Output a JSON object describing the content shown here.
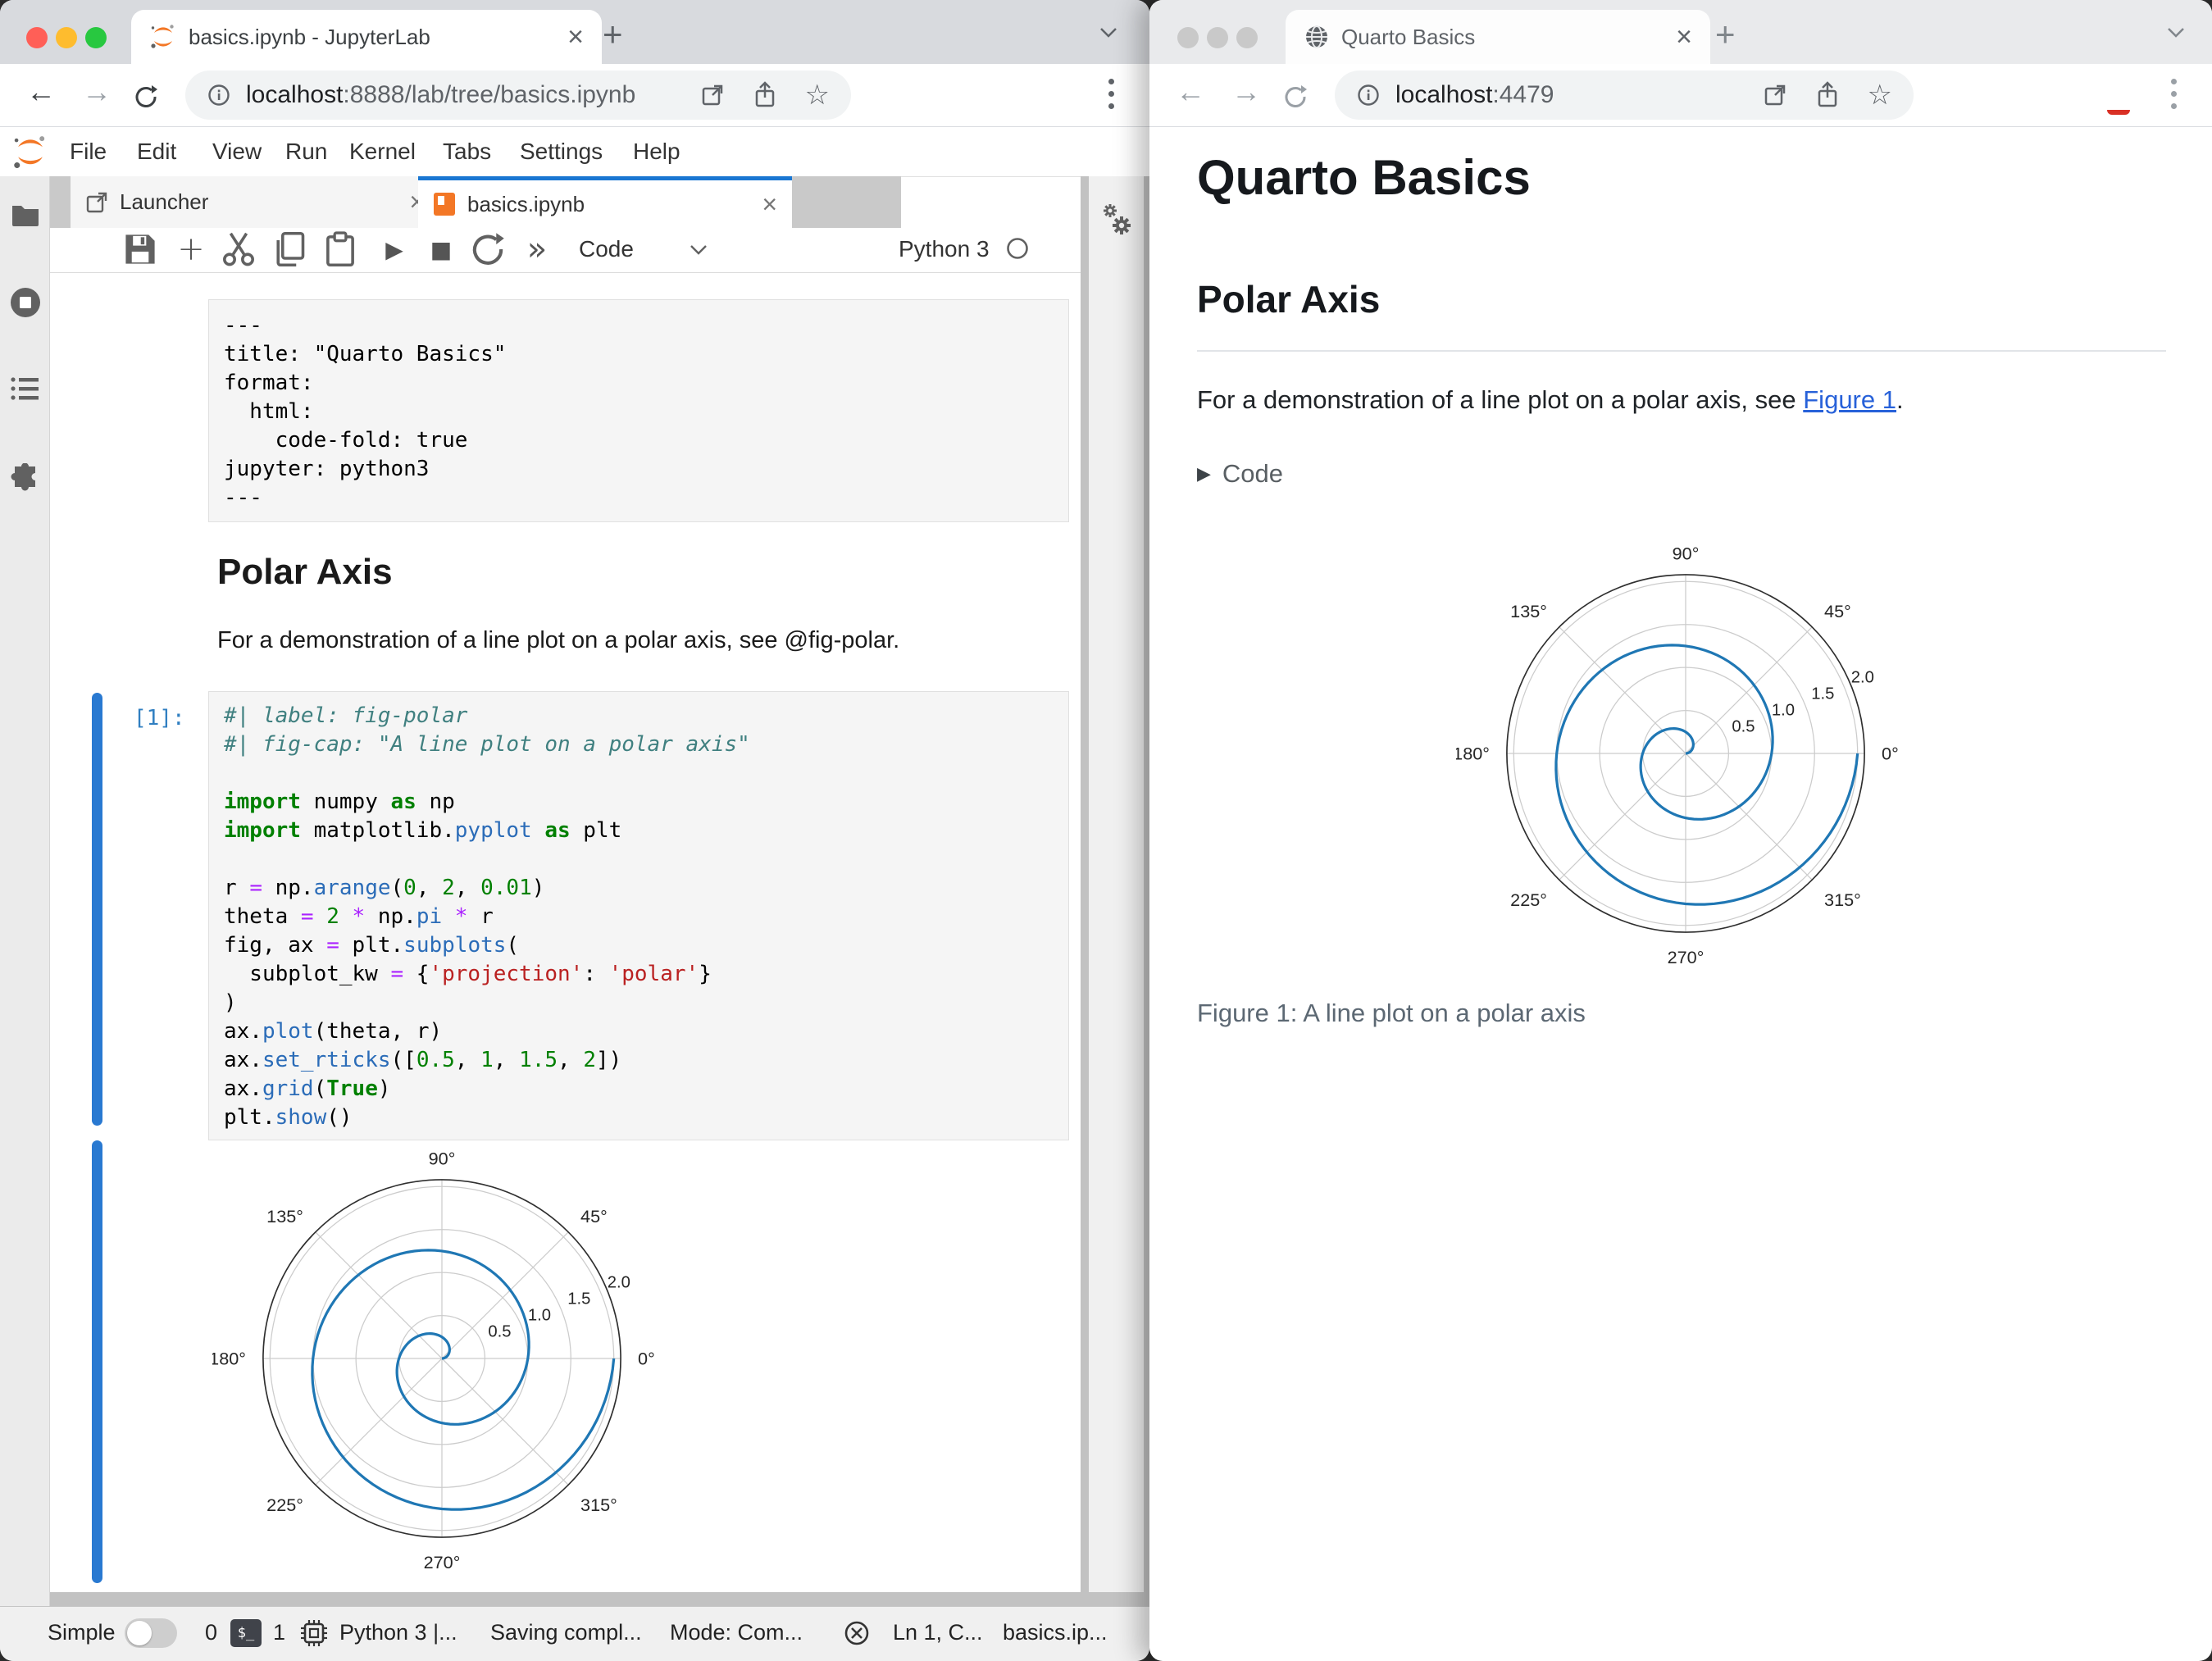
{
  "colors": {
    "accent_blue": "#2979d1",
    "tab_active_bar": "#1976d2",
    "jupyter_orange": "#f37726",
    "plot_line": "#1f77b4",
    "link_blue": "#2761d9",
    "traffic_red": "#ff5f57",
    "traffic_yellow": "#febc2e",
    "traffic_green": "#28c840",
    "traffic_inactive": "#c9c9c9"
  },
  "icons": {
    "back": "←",
    "forward": "→",
    "star": "☆",
    "plus": "+",
    "close": "×",
    "run": "▶",
    "stop": "■",
    "fastforward": "»",
    "caret": "⌄",
    "disclosure": "▶"
  },
  "left_window": {
    "tab_title": "basics.ipynb - JupyterLab",
    "url_host": "localhost",
    "url_rest": ":8888/lab/tree/basics.ipynb",
    "menus": [
      "File",
      "Edit",
      "View",
      "Run",
      "Kernel",
      "Tabs",
      "Settings",
      "Help"
    ],
    "doc_tabs": {
      "launcher": "Launcher",
      "notebook": "basics.ipynb"
    },
    "toolbar": {
      "cell_type": "Code",
      "kernel_name": "Python 3"
    },
    "yaml_lines": [
      "---",
      "title: \"Quarto Basics\"",
      "format:",
      "  html:",
      "    code-fold: true",
      "jupyter: python3",
      "---"
    ],
    "md_heading": "Polar Axis",
    "md_text": "For a demonstration of a line plot on a polar axis, see @fig-polar.",
    "prompt": "[1]:",
    "code_lines": [
      [
        {
          "c": "cm",
          "t": "#| label: fig-polar"
        }
      ],
      [
        {
          "c": "cm",
          "t": "#| fig-cap: \"A line plot on a polar axis\""
        }
      ],
      [],
      [
        {
          "c": "kw",
          "t": "import"
        },
        {
          "c": "pl",
          "t": " numpy "
        },
        {
          "c": "kw",
          "t": "as"
        },
        {
          "c": "pl",
          "t": " np"
        }
      ],
      [
        {
          "c": "kw",
          "t": "import"
        },
        {
          "c": "pl",
          "t": " matplotlib."
        },
        {
          "c": "fn",
          "t": "pyplot"
        },
        {
          "c": "pl",
          "t": " "
        },
        {
          "c": "kw",
          "t": "as"
        },
        {
          "c": "pl",
          "t": " plt"
        }
      ],
      [],
      [
        {
          "c": "pl",
          "t": "r "
        },
        {
          "c": "op",
          "t": "="
        },
        {
          "c": "pl",
          "t": " np."
        },
        {
          "c": "fn",
          "t": "arange"
        },
        {
          "c": "pl",
          "t": "("
        },
        {
          "c": "nb",
          "t": "0"
        },
        {
          "c": "pl",
          "t": ", "
        },
        {
          "c": "nb",
          "t": "2"
        },
        {
          "c": "pl",
          "t": ", "
        },
        {
          "c": "nb",
          "t": "0.01"
        },
        {
          "c": "pl",
          "t": ")"
        }
      ],
      [
        {
          "c": "pl",
          "t": "theta "
        },
        {
          "c": "op",
          "t": "="
        },
        {
          "c": "pl",
          "t": " "
        },
        {
          "c": "nb",
          "t": "2"
        },
        {
          "c": "pl",
          "t": " "
        },
        {
          "c": "op",
          "t": "*"
        },
        {
          "c": "pl",
          "t": " np."
        },
        {
          "c": "fn",
          "t": "pi"
        },
        {
          "c": "pl",
          "t": " "
        },
        {
          "c": "op",
          "t": "*"
        },
        {
          "c": "pl",
          "t": " r"
        }
      ],
      [
        {
          "c": "pl",
          "t": "fig, ax "
        },
        {
          "c": "op",
          "t": "="
        },
        {
          "c": "pl",
          "t": " plt."
        },
        {
          "c": "fn",
          "t": "subplots"
        },
        {
          "c": "pl",
          "t": "("
        }
      ],
      [
        {
          "c": "pl",
          "t": "  subplot_kw "
        },
        {
          "c": "op",
          "t": "="
        },
        {
          "c": "pl",
          "t": " {"
        },
        {
          "c": "st",
          "t": "'projection'"
        },
        {
          "c": "pl",
          "t": ": "
        },
        {
          "c": "st",
          "t": "'polar'"
        },
        {
          "c": "pl",
          "t": "}"
        }
      ],
      [
        {
          "c": "pl",
          "t": ")"
        }
      ],
      [
        {
          "c": "pl",
          "t": "ax."
        },
        {
          "c": "fn",
          "t": "plot"
        },
        {
          "c": "pl",
          "t": "(theta, r)"
        }
      ],
      [
        {
          "c": "pl",
          "t": "ax."
        },
        {
          "c": "fn",
          "t": "set_rticks"
        },
        {
          "c": "pl",
          "t": "(["
        },
        {
          "c": "nb",
          "t": "0.5"
        },
        {
          "c": "pl",
          "t": ", "
        },
        {
          "c": "nb",
          "t": "1"
        },
        {
          "c": "pl",
          "t": ", "
        },
        {
          "c": "nb",
          "t": "1.5"
        },
        {
          "c": "pl",
          "t": ", "
        },
        {
          "c": "nb",
          "t": "2"
        },
        {
          "c": "pl",
          "t": "])"
        }
      ],
      [
        {
          "c": "pl",
          "t": "ax."
        },
        {
          "c": "fn",
          "t": "grid"
        },
        {
          "c": "pl",
          "t": "("
        },
        {
          "c": "kw",
          "t": "True"
        },
        {
          "c": "pl",
          "t": ")"
        }
      ],
      [
        {
          "c": "pl",
          "t": "plt."
        },
        {
          "c": "fn",
          "t": "show"
        },
        {
          "c": "pl",
          "t": "()"
        }
      ]
    ],
    "statusbar": {
      "simple_label": "Simple",
      "terminals_count": "0",
      "kernels_count": "1",
      "kernel_status": "Python 3 |...",
      "saving_status": "Saving compl...",
      "mode": "Mode: Com...",
      "cursor_position": "Ln 1, C...",
      "file_name": "basics.ip..."
    }
  },
  "right_window": {
    "tab_title": "Quarto Basics",
    "url_host": "localhost",
    "url_rest": ":4479",
    "page": {
      "title": "Quarto Basics",
      "section_heading": "Polar Axis",
      "paragraph_before": "For a demonstration of a line plot on a polar axis, see ",
      "link_text": "Figure 1",
      "paragraph_after": ".",
      "code_toggle_label": "Code",
      "figure_caption": "Figure 1: A line plot on a polar axis"
    }
  },
  "chart_data": {
    "type": "line",
    "projection": "polar",
    "title": "",
    "xlabel": "",
    "ylabel": "",
    "series": [
      {
        "name": "spiral",
        "r_formula": "np.arange(0, 2, 0.01)",
        "theta_formula": "2 * np.pi * r",
        "r_start": 0,
        "r_end": 2,
        "turns": 2
      }
    ],
    "rticks": [
      0.5,
      1,
      1.5,
      2
    ],
    "rtick_labels": [
      "0.5",
      "1.0",
      "1.5",
      "2.0"
    ],
    "rlim": [
      0,
      2
    ],
    "theta_ticks_deg": [
      0,
      45,
      90,
      135,
      180,
      225,
      270,
      315
    ],
    "theta_tick_labels": [
      "0°",
      "45°",
      "90°",
      "135°",
      "180°",
      "225°",
      "270°",
      "315°"
    ],
    "grid": true,
    "line_color": "#1f77b4",
    "legend": "none"
  }
}
